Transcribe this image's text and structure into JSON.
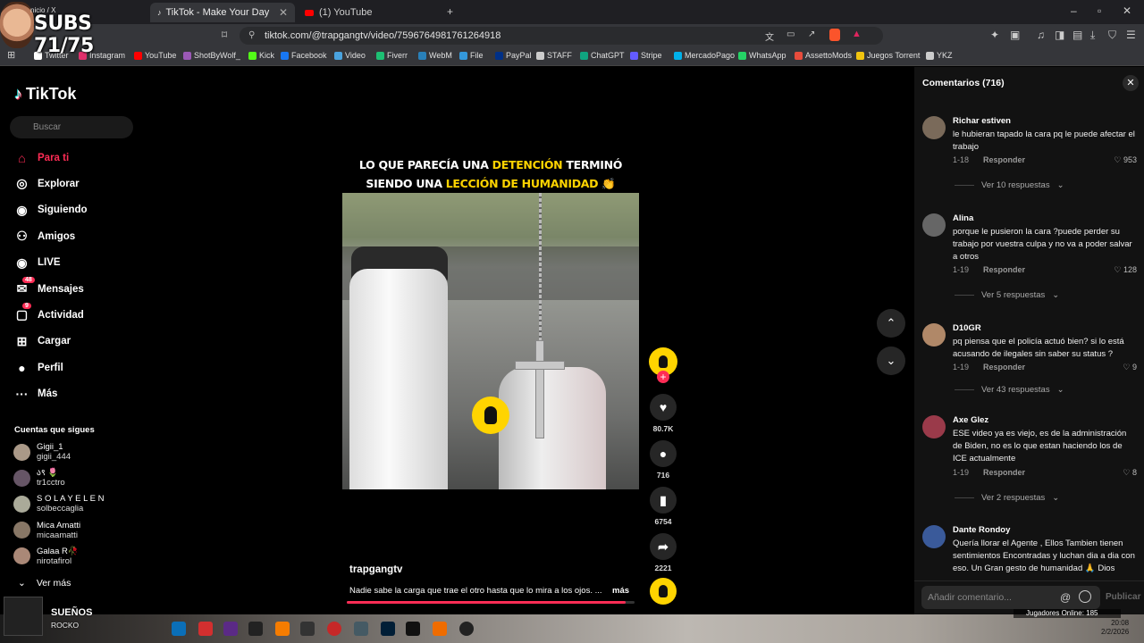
{
  "stream_overlay": {
    "label": "SUBS 71/75",
    "small": "nicio / X"
  },
  "browser": {
    "tabs": [
      {
        "title": "TikTok - Make Your Day",
        "active": true
      },
      {
        "title": "(1) YouTube",
        "active": false
      }
    ],
    "url": "tiktok.com/@trapgangtv/video/7596764981761264918",
    "bookmarks": [
      "Twitter",
      "Instagram",
      "YouTube",
      "ShotByWolf_",
      "Kick",
      "Facebook",
      "Video",
      "Fiverr",
      "WebM",
      "File",
      "PayPal",
      "STAFF",
      "ChatGPT",
      "Stripe",
      "MercadoPago",
      "WhatsApp",
      "AssettoMods",
      "Juegos Torrent",
      "YKZ"
    ],
    "bookmark_colors": [
      "#ffffff",
      "#e1306c",
      "#ff0000",
      "#9b59b6",
      "#53fc18",
      "#1877f2",
      "#4aa3df",
      "#1dbf73",
      "#2980b9",
      "#3498db",
      "#003087",
      "#cccccc",
      "#10a37f",
      "#635bff",
      "#00b1ea",
      "#25d366",
      "#e74c3c",
      "#f1c40f",
      "#cccccc"
    ]
  },
  "tiktok": {
    "logo": "TikTok",
    "search_placeholder": "Buscar",
    "nav": [
      {
        "label": "Para ti",
        "icon": "home-icon",
        "active": true
      },
      {
        "label": "Explorar",
        "icon": "compass-icon"
      },
      {
        "label": "Siguiendo",
        "icon": "following-icon"
      },
      {
        "label": "Amigos",
        "icon": "friends-icon"
      },
      {
        "label": "LIVE",
        "icon": "live-icon"
      },
      {
        "label": "Mensajes",
        "icon": "messages-icon",
        "badge": "48"
      },
      {
        "label": "Actividad",
        "icon": "activity-icon",
        "badge": "9"
      },
      {
        "label": "Cargar",
        "icon": "upload-icon"
      },
      {
        "label": "Perfil",
        "icon": "profile-icon"
      },
      {
        "label": "Más",
        "icon": "more-icon"
      }
    ],
    "following_title": "Cuentas que sigues",
    "following": [
      {
        "name": "Gigii_1",
        "handle": "gigii_444"
      },
      {
        "name": "ა९ 🌷",
        "handle": "tr1cctro"
      },
      {
        "name": "S O L A Y E L E N",
        "handle": "solbeccaglia"
      },
      {
        "name": "Mica Amatti",
        "handle": "micaamatti"
      },
      {
        "name": "Galaa R🥀",
        "handle": "nirotafirol"
      }
    ],
    "see_more": "Ver más",
    "video": {
      "caption_line1_a": "LO QUE PARECÍA UNA ",
      "caption_line1_hl": "DETENCIÓN",
      "caption_line1_b": " TERMINÓ",
      "caption_line2_a": "SIENDO UNA ",
      "caption_line2_hl": "LECCIÓN DE HUMANIDAD",
      "caption_line2_b": " 👏",
      "author": "trapgangtv",
      "description": "Nadie sabe la carga que trae el otro hasta que lo mira a los ojos. ...",
      "more": "más",
      "progress": 0.97
    },
    "actions": {
      "likes": "80.7K",
      "comments": "716",
      "saves": "6754",
      "shares": "2221"
    }
  },
  "comments_panel": {
    "title": "Comentarios",
    "count": "(716)",
    "items": [
      {
        "name": "Richar estiven",
        "text": "le hubieran tapado la cara pq le puede afectar el trabajo",
        "date": "1-18",
        "reply": "Responder",
        "likes": "953",
        "replies": "Ver 10 respuestas"
      },
      {
        "name": "Alina",
        "text": "porque le pusieron la cara ?puede perder su trabajo por vuestra culpa y no va a poder salvar a otros",
        "date": "1-19",
        "reply": "Responder",
        "likes": "128",
        "replies": "Ver 5 respuestas"
      },
      {
        "name": "D10GR",
        "text": "pq piensa que el policía actuó bien? si lo está acusando de ilegales sin saber su status ?",
        "date": "1-19",
        "reply": "Responder",
        "likes": "9",
        "replies": "Ver 43 respuestas"
      },
      {
        "name": "Axe Glez",
        "text": "ESE video ya es viejo, es de la administración de Biden, no es lo que estan haciendo los de ICE actualmente",
        "date": "1-19",
        "reply": "Responder",
        "likes": "8",
        "replies": "Ver 2 respuestas"
      },
      {
        "name": "Dante Rondoy",
        "text": "Quería llorar el Agente , Ellos Tambien tienen sentimientos Encontradas y luchan dia a dia con eso. Un Gran gesto de humanidad 🙏 Dios"
      }
    ],
    "input_placeholder": "Añadir comentario...",
    "post_label": "Publicar"
  },
  "taskbar": {
    "song_title": "SUEÑOS",
    "song_artist": "ROCKO",
    "overlay_text": "Jugadores Online: 185",
    "time": "20:08",
    "date": "2/2/2026"
  }
}
